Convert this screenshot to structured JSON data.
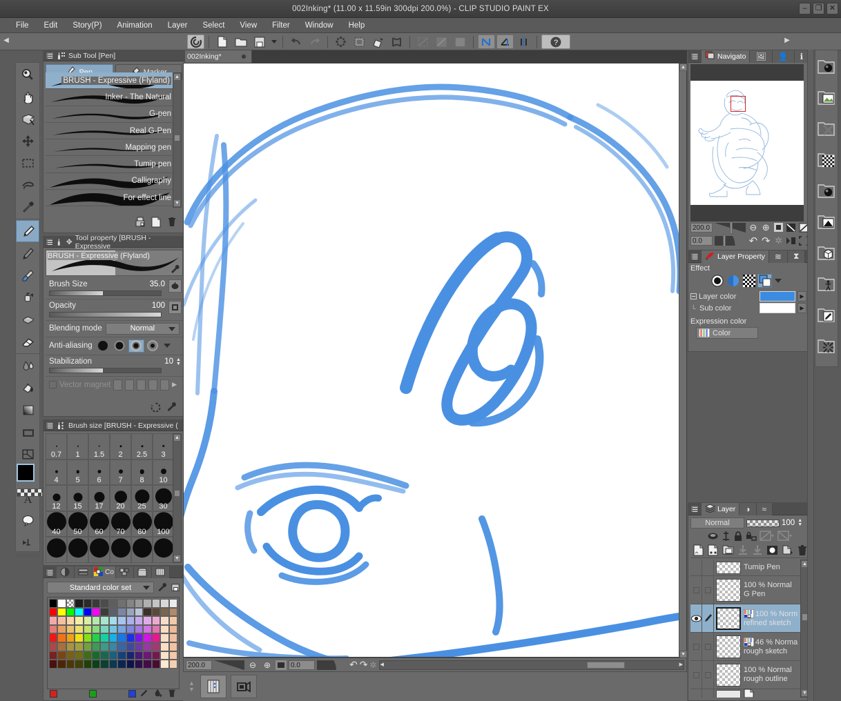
{
  "window": {
    "title": "002Inking* (11.00 x 11.59in 300dpi 200.0%)  - CLIP STUDIO PAINT EX",
    "minimize": "–",
    "maximize": "❐",
    "close": "✕"
  },
  "menubar": {
    "items": [
      "File",
      "Edit",
      "Story(P)",
      "Animation",
      "Layer",
      "Select",
      "View",
      "Filter",
      "Window",
      "Help"
    ]
  },
  "commandbar": {
    "left_arrow": "◀",
    "right_arrow": "▶",
    "buttons": [
      {
        "name": "clip-studio-icon",
        "glyph": "◉"
      },
      {
        "name": "new-file-icon",
        "glyph": "🗋"
      },
      {
        "name": "open-file-icon",
        "glyph": "🗁"
      },
      {
        "name": "save-icon",
        "glyph": "▣"
      },
      {
        "name": "save-dropdown-icon",
        "glyph": "▾"
      },
      {
        "name": "undo-icon",
        "glyph": "↩"
      },
      {
        "name": "redo-icon",
        "glyph": "↪"
      },
      {
        "name": "deselect-icon",
        "glyph": "❈"
      },
      {
        "name": "invert-selection-icon",
        "glyph": "▤"
      },
      {
        "name": "fill-selection-icon",
        "glyph": "✎"
      },
      {
        "name": "grow-selection-icon",
        "glyph": "✕"
      },
      {
        "name": "clear-icon",
        "glyph": "◩"
      },
      {
        "name": "fill-icon",
        "glyph": "◪"
      },
      {
        "name": "select-area-icon",
        "glyph": "▦"
      },
      {
        "name": "snap-ruler-icon",
        "glyph": "N"
      },
      {
        "name": "snap-perspective-icon",
        "glyph": "⌐"
      },
      {
        "name": "snap-symmetry-icon",
        "glyph": "⊞"
      },
      {
        "name": "help-icon",
        "glyph": "?"
      }
    ]
  },
  "document_tab": {
    "label": "002Inking*",
    "modified_dot": "●"
  },
  "toolbar": {
    "tools": [
      {
        "name": "zoom-tool",
        "glyph": "🔍"
      },
      {
        "name": "hand-tool",
        "glyph": "✋"
      },
      {
        "name": "rotate-tool",
        "glyph": "▱"
      },
      {
        "name": "move-tool",
        "glyph": "✥"
      },
      {
        "name": "marquee-select-tool",
        "glyph": "▭"
      },
      {
        "name": "lasso-select-tool",
        "glyph": "✒"
      },
      {
        "name": "eyedropper-tool",
        "glyph": "⚲"
      },
      {
        "name": "pen-tool",
        "glyph": "✎",
        "selected": true
      },
      {
        "name": "pencil-tool",
        "glyph": "✏"
      },
      {
        "name": "brush-tool",
        "glyph": "🖌"
      },
      {
        "name": "airbrush-tool",
        "glyph": "⛾"
      },
      {
        "name": "decoration-tool",
        "glyph": "❖"
      },
      {
        "name": "eraser-tool",
        "glyph": "▭"
      },
      {
        "name": "blend-tool",
        "glyph": "◗"
      },
      {
        "name": "fill-tool",
        "glyph": "⬗"
      },
      {
        "name": "gradient-tool",
        "glyph": "▨"
      },
      {
        "name": "figure-tool",
        "glyph": "▭"
      },
      {
        "name": "frame-border-tool",
        "glyph": "⊞"
      },
      {
        "name": "ruler-tool",
        "glyph": "◺"
      },
      {
        "name": "text-tool",
        "glyph": "A"
      },
      {
        "name": "balloon-tool",
        "glyph": "◯"
      },
      {
        "name": "correct-line-tool",
        "glyph": "➤"
      }
    ],
    "foreground_color": "#000000",
    "background_color": "#ffffff",
    "transparent_label": "transparency"
  },
  "subtool": {
    "panel_title": "Sub Tool [Pen]",
    "tabs": [
      {
        "label": "Pen",
        "icon": "pen-nib-icon",
        "active": true
      },
      {
        "label": "Marker",
        "icon": "marker-icon",
        "active": false
      }
    ],
    "items": [
      {
        "label": "BRUSH - Expressive (Flyland)",
        "selected": true
      },
      {
        "label": "Inker - The Natural",
        "selected": false
      },
      {
        "label": "G-pen",
        "selected": false
      },
      {
        "label": "Real G-Pen",
        "selected": false
      },
      {
        "label": "Mapping pen",
        "selected": false
      },
      {
        "label": "Tumip pen",
        "selected": false
      },
      {
        "label": "Calligraphy",
        "selected": false
      },
      {
        "label": "For effect line",
        "selected": false
      }
    ],
    "footer_buttons": [
      {
        "name": "show-all-subtools-icon",
        "glyph": "⎙"
      },
      {
        "name": "create-new-subtool-icon",
        "glyph": "🗋"
      },
      {
        "name": "delete-subtool-icon",
        "glyph": "🗑"
      }
    ]
  },
  "toolproperty": {
    "panel_title": "Tool property [BRUSH - Expressive",
    "preview_label_hl": "BRUSH - Expressive",
    "preview_label_rest": " (Flyland)",
    "rows": {
      "brush_size": {
        "label": "Brush Size",
        "value": "35.0",
        "fill_pct": 48
      },
      "opacity": {
        "label": "Opacity",
        "value": "100",
        "fill_pct": 100
      },
      "blending_mode": {
        "label": "Blending mode",
        "value": "Normal"
      },
      "anti_aliasing": {
        "label": "Anti-aliasing",
        "selected_index": 2
      },
      "stabilization": {
        "label": "Stabilization",
        "value": "10",
        "fill_pct": 48
      },
      "vector_magnet": {
        "label": "Vector magnet",
        "enabled": false
      }
    },
    "footer_buttons": [
      {
        "name": "reset-settings-icon",
        "glyph": "↻"
      },
      {
        "name": "sub-tool-detail-icon",
        "glyph": "🔧"
      }
    ]
  },
  "brushsize": {
    "panel_title": "Brush size [BRUSH - Expressive (",
    "rows": [
      [
        {
          "label": "0.7",
          "dot": 2
        },
        {
          "label": "1",
          "dot": 2
        },
        {
          "label": "1.5",
          "dot": 2.5
        },
        {
          "label": "2",
          "dot": 3
        },
        {
          "label": "2.5",
          "dot": 3
        },
        {
          "label": "3",
          "dot": 3.5
        }
      ],
      [
        {
          "label": "4",
          "dot": 4
        },
        {
          "label": "5",
          "dot": 4.5
        },
        {
          "label": "6",
          "dot": 5
        },
        {
          "label": "7",
          "dot": 6
        },
        {
          "label": "8",
          "dot": 6.5
        },
        {
          "label": "10",
          "dot": 8
        }
      ],
      [
        {
          "label": "12",
          "dot": 11
        },
        {
          "label": "15",
          "dot": 13
        },
        {
          "label": "17",
          "dot": 15
        },
        {
          "label": "20",
          "dot": 18
        },
        {
          "label": "25",
          "dot": 21
        },
        {
          "label": "30",
          "dot": 24
        }
      ],
      [
        {
          "label": "40",
          "dot": 28
        },
        {
          "label": "50",
          "dot": 28
        },
        {
          "label": "60",
          "dot": 28
        },
        {
          "label": "70",
          "dot": 28
        },
        {
          "label": "80",
          "dot": 28
        },
        {
          "label": "100",
          "dot": 28
        }
      ],
      [
        {
          "label": "",
          "dot": 28
        },
        {
          "label": "",
          "dot": 28
        },
        {
          "label": "",
          "dot": 28
        },
        {
          "label": "",
          "dot": 28
        },
        {
          "label": "",
          "dot": 28
        },
        {
          "label": "",
          "dot": 28
        }
      ]
    ]
  },
  "colorset": {
    "tabs": [
      {
        "name": "color-wheel-tab",
        "glyph": "◕"
      },
      {
        "name": "color-slider-tab",
        "glyph": "▤"
      },
      {
        "name": "color-set-tab",
        "label": "Co",
        "active": true
      },
      {
        "name": "intermediate-color-tab",
        "glyph": "⊞"
      },
      {
        "name": "material-tab",
        "glyph": "🗃"
      },
      {
        "name": "timeline-tab",
        "glyph": "▥"
      }
    ],
    "selected_set": "Standard color set",
    "footer_markers": [
      "#d82020",
      "#18a018",
      "#2040d8"
    ],
    "footer_buttons": [
      {
        "name": "edit-color-set-icon",
        "glyph": "✎"
      },
      {
        "name": "add-color-icon",
        "glyph": "◍"
      },
      {
        "name": "delete-color-icon",
        "glyph": "🗑"
      }
    ],
    "palette_rows": [
      [
        "#000000",
        "#ffffff",
        "#cccccc",
        "#1c1c1c",
        "#2b2b2b",
        "#3a3a3a",
        "#4c4c4c",
        "#5e5e5e",
        "#707070",
        "#858585",
        "#9a9a9a",
        "#b0b0b0",
        "#c4c4c4",
        "#d8d8d8",
        "#ececec"
      ],
      [
        "#ff0000",
        "#ffff00",
        "#00ff00",
        "#00ffff",
        "#0000ff",
        "#ff00ff",
        "#3d3d3d",
        "#5a5f6b",
        "#7b86a2",
        "#9aa5bd",
        "#bcc4d6",
        "#3c3128",
        "#5a4a3a",
        "#7a6650",
        "#b08a6a"
      ],
      [
        "#f4a8a8",
        "#f4c0a0",
        "#f6d8a6",
        "#f4eea4",
        "#d8eea4",
        "#b4e8ae",
        "#a8e6cc",
        "#a6dbea",
        "#a8c4ee",
        "#aab0ea",
        "#c4aaea",
        "#e0aae6",
        "#eeaace",
        "#f6dccb",
        "#f2c9a9"
      ],
      [
        "#e87878",
        "#e8a060",
        "#eac070",
        "#e8e070",
        "#c0e070",
        "#8cd880",
        "#78d6ba",
        "#74c4e0",
        "#76a4e4",
        "#8086e0",
        "#a67ae0",
        "#d074de",
        "#e274ae",
        "#f7ddc5",
        "#eeb995"
      ],
      [
        "#f01616",
        "#f07416",
        "#f0a016",
        "#f0e016",
        "#86e016",
        "#24d24a",
        "#16d0a4",
        "#16b0ea",
        "#1678ea",
        "#1632ea",
        "#7a16ea",
        "#d016e4",
        "#ea1690",
        "#f8e0c8",
        "#efc0a0"
      ],
      [
        "#a84a4a",
        "#a8703c",
        "#a89442",
        "#a0a040",
        "#74a040",
        "#3e9a56",
        "#3c9a86",
        "#3a86a8",
        "#3a64a6",
        "#40489e",
        "#6a3c9e",
        "#963aa0",
        "#a03a74",
        "#fadfc7",
        "#f0c3a1"
      ],
      [
        "#7a2020",
        "#7a4414",
        "#7a6014",
        "#6e6e14",
        "#3e6e14",
        "#186a2c",
        "#18684e",
        "#186080",
        "#184078",
        "#1a2470",
        "#4a1a74",
        "#6c1874",
        "#761850",
        "#fbe3cb",
        "#f2c9a9"
      ],
      [
        "#4a1010",
        "#4a2608",
        "#4a3808",
        "#404008",
        "#204008",
        "#0c4018",
        "#0c4030",
        "#0c3850",
        "#0c2450",
        "#0e1448",
        "#2c0e48",
        "#420c48",
        "#480c30",
        "#fde8d2",
        "#f4d0b2"
      ]
    ]
  },
  "canvas": {
    "zoom": "200.0",
    "rotation": "0.0",
    "stroke_color": "#4a90e2",
    "statusbar_buttons": [
      {
        "name": "zoom-out-icon",
        "glyph": "⊖"
      },
      {
        "name": "zoom-in-icon",
        "glyph": "⊕"
      },
      {
        "name": "fit-to-screen-icon",
        "glyph": "▣"
      },
      {
        "name": "rotate-left-icon",
        "glyph": "↶"
      },
      {
        "name": "rotate-right-icon",
        "glyph": "↷"
      },
      {
        "name": "reset-rotation-icon",
        "glyph": "↻"
      }
    ],
    "bottom_buttons": [
      {
        "name": "timeline-toggle-icon",
        "glyph": "▥",
        "active": true
      },
      {
        "name": "animation-cels-icon",
        "glyph": "🎬",
        "active": false
      }
    ],
    "scroll_up_icon": "▲",
    "scroll_down_icon": "▼"
  },
  "navigator": {
    "tabs": [
      {
        "label": "Navigato",
        "name": "navigator-tab",
        "active": true
      },
      {
        "label": "",
        "name": "item-bank-tab",
        "glyph": "🖼",
        "active": false
      },
      {
        "label": "",
        "name": "subview-tab",
        "glyph": "👤",
        "active": false
      },
      {
        "label": "",
        "name": "information-tab",
        "glyph": "ℹ",
        "active": false
      }
    ],
    "zoom": "200.0",
    "rotation": "0.0",
    "buttons": [
      {
        "name": "nav-zoom-out-icon",
        "glyph": "⊖"
      },
      {
        "name": "nav-zoom-in-icon",
        "glyph": "⊕"
      },
      {
        "name": "nav-fit-icon",
        "glyph": "▣"
      },
      {
        "name": "nav-flip-horizontal-icon",
        "glyph": "◺"
      },
      {
        "name": "nav-flip-vertical-icon",
        "glyph": "◿"
      },
      {
        "name": "nav-rotate-left-icon",
        "glyph": "↶"
      },
      {
        "name": "nav-rotate-right-icon",
        "glyph": "↷"
      },
      {
        "name": "nav-reset-rotate-icon",
        "glyph": "↻"
      },
      {
        "name": "nav-preview-icon",
        "glyph": "▶"
      },
      {
        "name": "nav-full-screen-icon",
        "glyph": "⛶"
      }
    ]
  },
  "layerproperty": {
    "tabs": [
      {
        "label": "Layer Property",
        "name": "layer-property-tab",
        "active": true
      },
      {
        "label": "",
        "name": "animation-tab",
        "glyph": "≋",
        "active": false
      },
      {
        "label": "",
        "name": "quick-access-tab",
        "glyph": "⧗",
        "active": false
      }
    ],
    "effect_label": "Effect",
    "effect_buttons": [
      {
        "name": "border-effect-icon",
        "glyph": "●"
      },
      {
        "name": "tone-effect-icon",
        "glyph": "◐"
      },
      {
        "name": "halftone-effect-icon",
        "glyph": "▦"
      },
      {
        "name": "layer-color-effect-icon",
        "glyph": "▣",
        "selected": true
      },
      {
        "name": "effect-more-icon",
        "glyph": "▾"
      }
    ],
    "layer_color_label": "Layer color",
    "layer_color": "#3b8ce0",
    "sub_color_label": "Sub color",
    "sub_color": "#ffffff",
    "expression_color_label": "Expression color",
    "expression_color_value": "Color"
  },
  "layerpanel": {
    "tabs": [
      {
        "label": "Layer",
        "name": "layer-tab",
        "active": true
      },
      {
        "label": "",
        "name": "layer-mask-tab",
        "glyph": "◑",
        "active": false
      },
      {
        "label": "",
        "name": "timeline-tab",
        "glyph": "≈",
        "active": false
      }
    ],
    "blending_mode": "Normal",
    "opacity": "100",
    "prop_icons": [
      {
        "name": "palette-color-icon",
        "glyph": "⬭"
      },
      {
        "name": "ruler-visibility-icon",
        "glyph": "⌶"
      },
      {
        "name": "lock-layer-icon",
        "glyph": "🔒"
      },
      {
        "name": "lock-transparent-pixels-icon",
        "glyph": "🔓"
      },
      {
        "name": "mask-enable-icon",
        "glyph": "▨"
      },
      {
        "name": "mask-range-icon",
        "glyph": "▧"
      }
    ],
    "action_icons": [
      {
        "name": "new-raster-layer-icon",
        "glyph": "🗋"
      },
      {
        "name": "new-vector-layer-icon",
        "glyph": "🗏"
      },
      {
        "name": "new-layer-folder-icon",
        "glyph": "🗀"
      },
      {
        "name": "transfer-down-icon",
        "glyph": "⤓"
      },
      {
        "name": "combine-down-icon",
        "glyph": "⤓"
      },
      {
        "name": "create-mask-icon",
        "glyph": "◖"
      },
      {
        "name": "apply-mask-icon",
        "glyph": "◪"
      },
      {
        "name": "delete-layer-icon",
        "glyph": "🗑"
      }
    ],
    "layers": [
      {
        "opacity_mode": "",
        "name": "Tumip Pen",
        "selected": false,
        "visible": false,
        "expression_color": false,
        "partial": true
      },
      {
        "opacity_mode": "100 % Normal",
        "name": "G Pen",
        "selected": false,
        "visible": false,
        "expression_color": false
      },
      {
        "opacity_mode": "100 % Norm",
        "name": "refined sketch",
        "selected": true,
        "visible": true,
        "expression_color": true
      },
      {
        "opacity_mode": "46 % Norma",
        "name": "rough sketch",
        "selected": false,
        "visible": false,
        "expression_color": true
      },
      {
        "opacity_mode": "100 % Normal",
        "name": "rough outline",
        "selected": false,
        "visible": false,
        "expression_color": false
      }
    ]
  },
  "right_rail": {
    "buttons": [
      {
        "name": "material-color-pattern-icon",
        "glyph": "●"
      },
      {
        "name": "material-image-icon",
        "glyph": "🖼"
      },
      {
        "name": "material-manga-icon",
        "glyph": "✕"
      },
      {
        "name": "material-monochrome-pattern-icon",
        "glyph": "▦"
      },
      {
        "name": "material-color-pattern2-icon",
        "glyph": "◍"
      },
      {
        "name": "material-gradient-icon",
        "glyph": "◣"
      },
      {
        "name": "material-3d-icon",
        "glyph": "⬢"
      },
      {
        "name": "material-3d-body-icon",
        "glyph": "⚇"
      },
      {
        "name": "material-download-icon",
        "glyph": "✎"
      },
      {
        "name": "material-effect-line-icon",
        "glyph": "✳"
      }
    ]
  }
}
